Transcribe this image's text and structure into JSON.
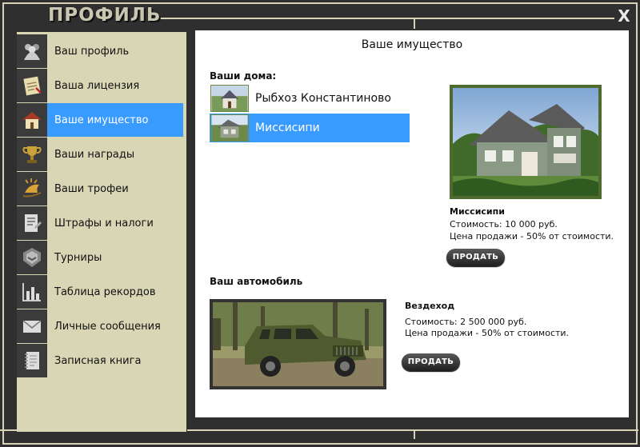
{
  "window": {
    "title": "ПРОФИЛЬ",
    "close_label": "X"
  },
  "sidebar": {
    "items": [
      {
        "label": "Ваш профиль",
        "icon": "users-icon"
      },
      {
        "label": "Ваша лицензия",
        "icon": "license-icon"
      },
      {
        "label": "Ваше имущество",
        "icon": "house-icon",
        "active": true
      },
      {
        "label": "Ваши награды",
        "icon": "trophy-icon"
      },
      {
        "label": "Ваши трофеи",
        "icon": "hunting-trophy-icon"
      },
      {
        "label": "Штрафы и налоги",
        "icon": "document-icon"
      },
      {
        "label": "Турниры",
        "icon": "emblem-icon"
      },
      {
        "label": "Таблица рекордов",
        "icon": "bar-chart-icon"
      },
      {
        "label": "Личные сообщения",
        "icon": "envelope-icon"
      },
      {
        "label": "Записная книга",
        "icon": "notebook-icon"
      }
    ]
  },
  "property": {
    "title": "Ваше имущество",
    "houses_label": "Ваши дома:",
    "houses": [
      {
        "name": "Рыбхоз Константиново"
      },
      {
        "name": "Миссисипи",
        "selected": true
      }
    ],
    "selected_house": {
      "name": "Миссисипи",
      "cost": "Стоимость: 10 000 руб.",
      "sale": "Цена продажи - 50% от стоимости.",
      "sell_label": "ПРОДАТЬ"
    },
    "car_label": "Ваш автомобиль",
    "car": {
      "name": "Вездеход",
      "cost": "Стоимость: 2 500 000 руб.",
      "sale": "Цена продажи - 50% от стоимости.",
      "sell_label": "ПРОДАТЬ"
    }
  },
  "colors": {
    "accent": "#3a9bff",
    "sidebar_bg": "#d8d6b5",
    "frame": "#2f2f2f",
    "border": "#d7d4b6"
  }
}
